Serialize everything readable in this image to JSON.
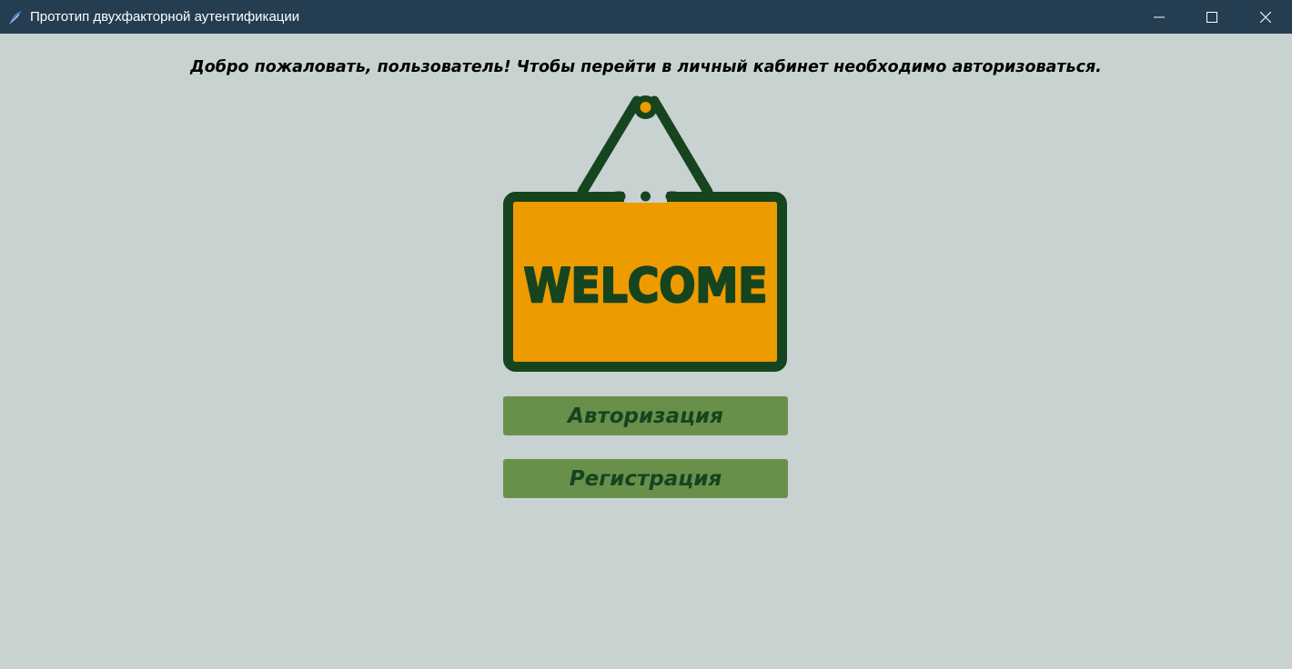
{
  "window": {
    "title": "Прототип двухфакторной аутентификации",
    "app_icon": "python-feather-icon",
    "controls": {
      "minimize_icon": "minimize-icon",
      "maximize_icon": "maximize-icon",
      "close_icon": "close-icon"
    }
  },
  "main": {
    "welcome_message": "Добро пожаловать, пользователь! Чтобы перейти в личный кабинет необходимо авторизоваться.",
    "sign": {
      "text": "WELCOME",
      "icon": "welcome-sign-icon"
    },
    "buttons": {
      "login_label": "Авторизация",
      "register_label": "Регистрация"
    }
  },
  "colors": {
    "titlebar": "#243d51",
    "background": "#c8d2d1",
    "button_fill": "#68904b",
    "button_text": "#16441f",
    "sign_fill": "#ee9b00",
    "sign_outline": "#16441f"
  }
}
